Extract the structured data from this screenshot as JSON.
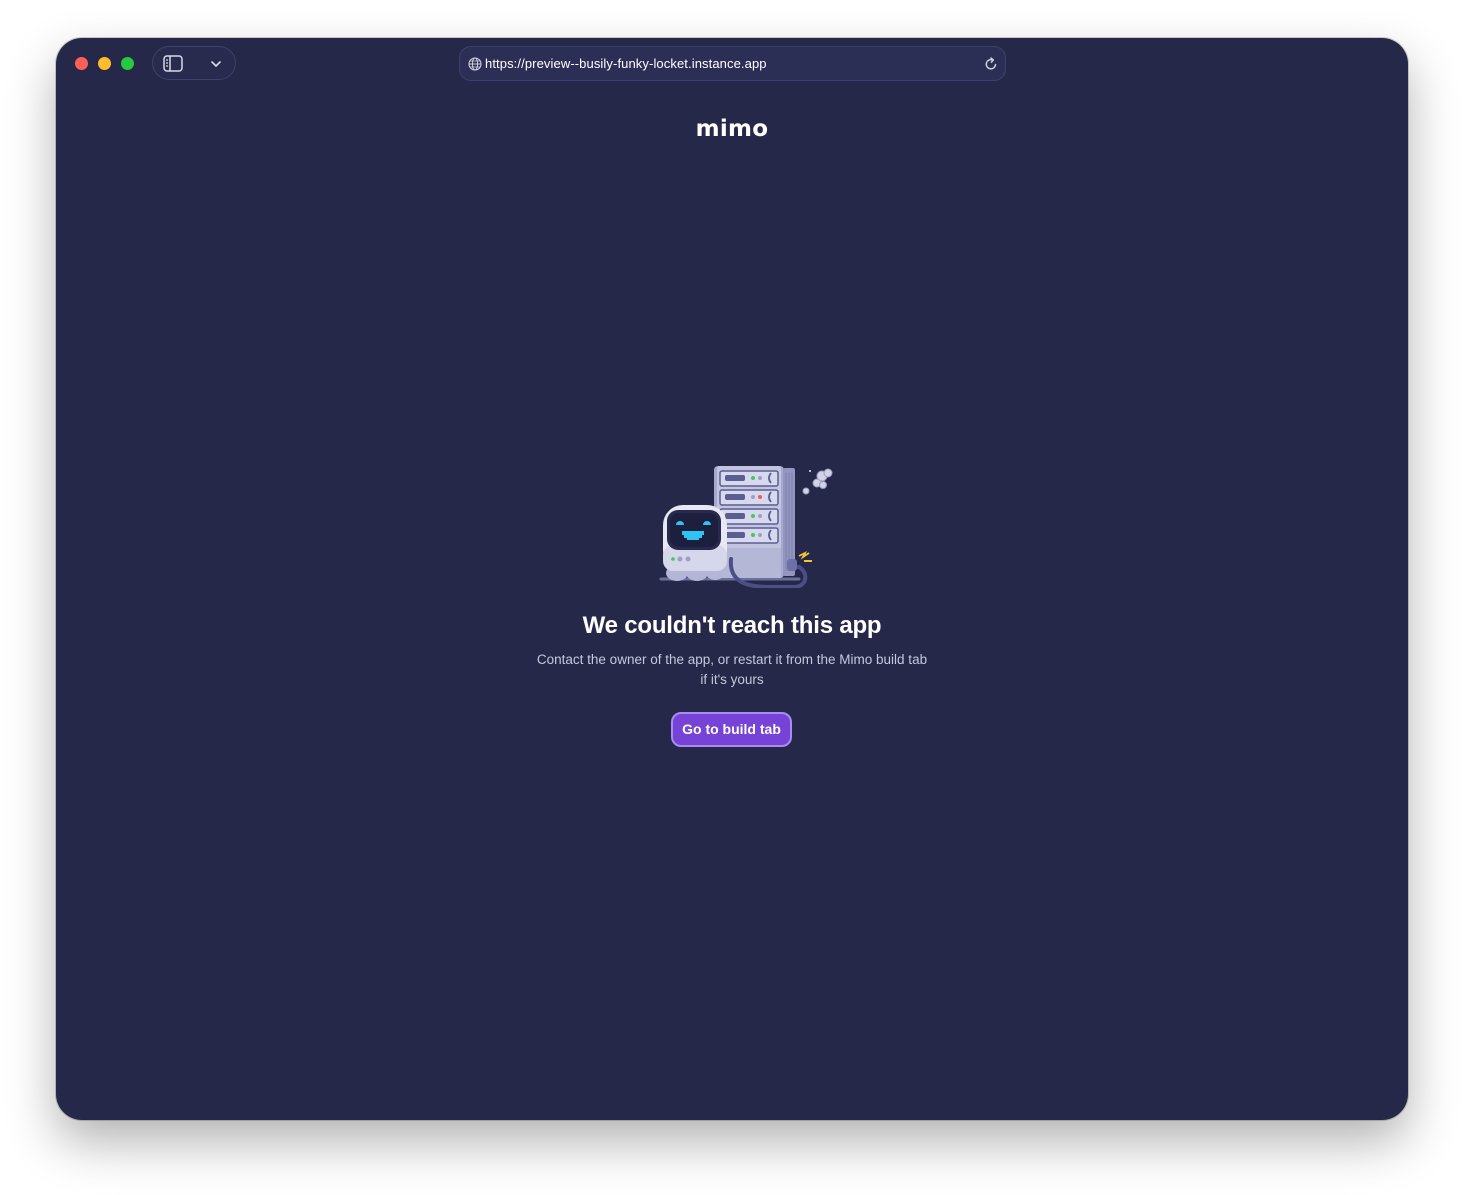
{
  "browser": {
    "url": "https://preview--busily-funky-locket.instance.app",
    "icons": {
      "sidebar_toggle": "sidebar-icon",
      "tab_menu": "chevron-down-icon",
      "site_info": "globe-icon",
      "reload": "reload-icon"
    }
  },
  "page": {
    "logo_text": "mimo",
    "headline": "We couldn't reach this app",
    "description": "Contact the owner of the app, or restart it from the Mimo build tab if it's yours",
    "cta_label": "Go to build tab",
    "illustration": "robot-with-broken-server-icon"
  },
  "colors": {
    "background": "#252848",
    "button": "#7743d6",
    "button_border": "#a88cf0",
    "robot_visor": "#2ec4f2"
  }
}
